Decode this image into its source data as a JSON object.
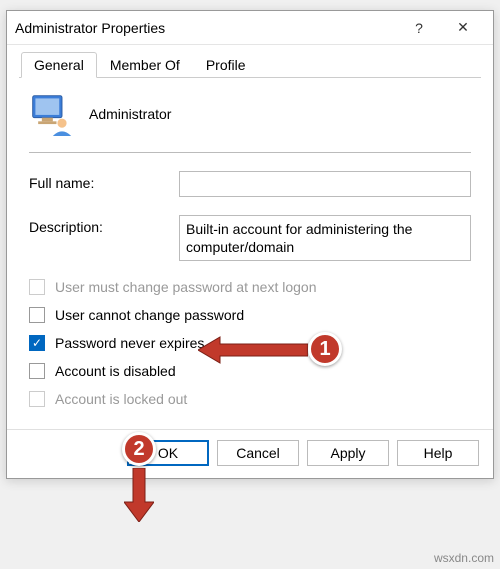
{
  "dialog": {
    "title": "Administrator Properties",
    "help_glyph": "?",
    "close_glyph": "✕"
  },
  "tabs": {
    "general": "General",
    "member_of": "Member Of",
    "profile": "Profile"
  },
  "header": {
    "username": "Administrator"
  },
  "fields": {
    "full_name_label": "Full name:",
    "full_name_value": "",
    "description_label": "Description:",
    "description_value": "Built-in account for administering the computer/domain"
  },
  "checkboxes": {
    "must_change": "User must change password at next logon",
    "cannot_change": "User cannot change password",
    "never_expires": "Password never expires",
    "disabled": "Account is disabled",
    "locked": "Account is locked out"
  },
  "buttons": {
    "ok": "OK",
    "cancel": "Cancel",
    "apply": "Apply",
    "help": "Help"
  },
  "annotations": {
    "step1": "1",
    "step2": "2"
  },
  "watermark": "wsxdn.com"
}
